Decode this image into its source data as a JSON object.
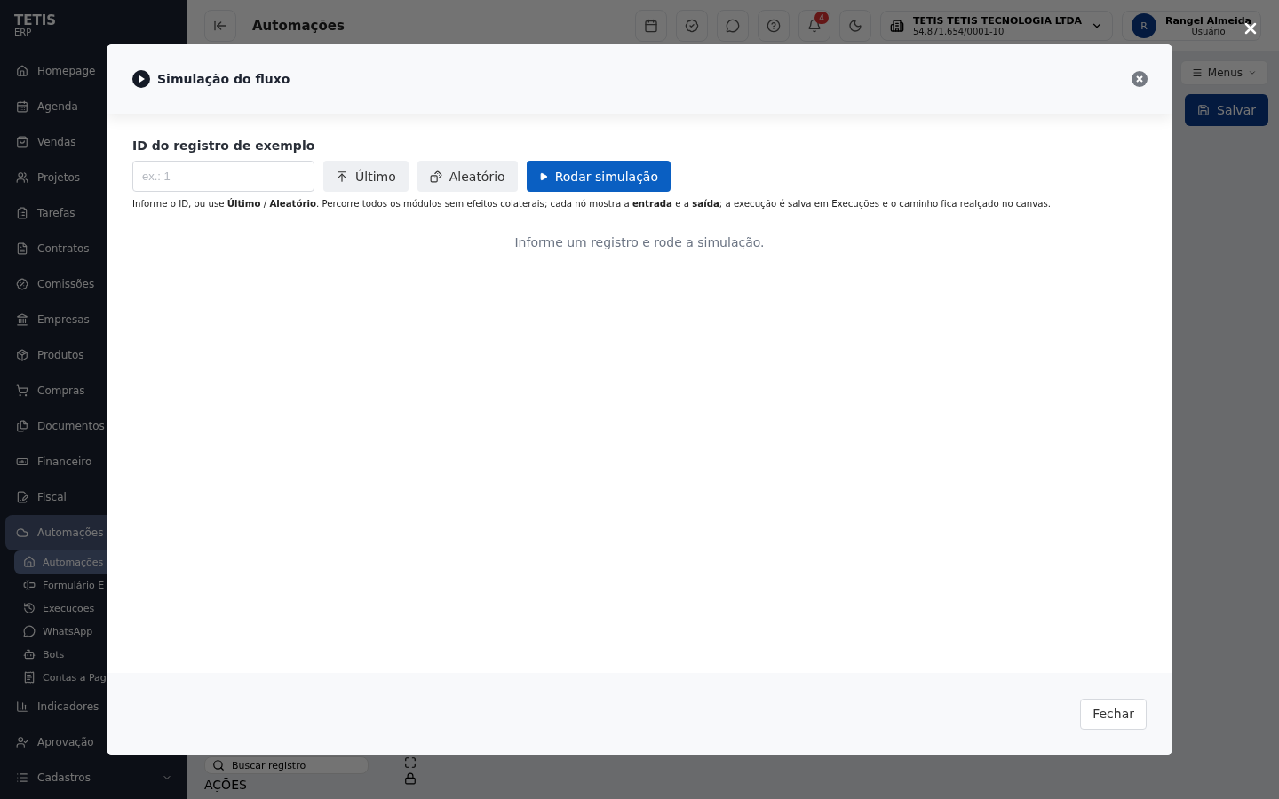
{
  "app": {
    "logo": {
      "name": "TETIS",
      "sub": "ERP"
    },
    "sidebar": {
      "items": [
        {
          "label": "Homepage",
          "selected": false
        },
        {
          "label": "Agenda",
          "selected": false
        },
        {
          "label": "Vendas",
          "selected": false
        },
        {
          "label": "Projetos",
          "selected": false
        },
        {
          "label": "Tarefas",
          "selected": false
        },
        {
          "label": "Contratos",
          "selected": false
        },
        {
          "label": "Comissões",
          "selected": false
        },
        {
          "label": "Empresas",
          "selected": false
        },
        {
          "label": "Produtos",
          "selected": false
        },
        {
          "label": "Compras",
          "selected": false
        },
        {
          "label": "Documentos",
          "selected": false
        },
        {
          "label": "Financeiro",
          "selected": false
        },
        {
          "label": "Fiscal",
          "selected": false
        },
        {
          "label": "Automações",
          "selected": true,
          "expanded": true,
          "children": [
            {
              "label": "Automações",
              "selected": true
            },
            {
              "label": "Formulário E",
              "selected": false
            },
            {
              "label": "Execuções",
              "selected": false
            },
            {
              "label": "WhatsApp",
              "selected": false
            },
            {
              "label": "Bots",
              "selected": false
            },
            {
              "label": "Contas a Pag",
              "selected": false
            }
          ]
        },
        {
          "label": "Indicadores",
          "selected": false
        },
        {
          "label": "Aprovação",
          "selected": false
        },
        {
          "label": "Cadastros",
          "selected": false,
          "expanded": false
        }
      ]
    },
    "topbar": {
      "title": "Automações",
      "notification_count": "4",
      "company": {
        "name": "TETIS TETIS TECNOLOGIA LTDA",
        "document": "54.871.654/0001-10"
      },
      "user": {
        "initial": "R",
        "name": "Rangel Almeida",
        "role": "Usuário"
      }
    },
    "toolbar": {
      "menus": "Menus",
      "save": "Salvar"
    },
    "canvas": {
      "search": "Buscar registro",
      "section": "AÇÕES"
    }
  },
  "modal": {
    "title": "Simulação do fluxo",
    "field_label": "ID do registro de exemplo",
    "placeholder": "ex.: 1",
    "buttons": [
      {
        "label": "Último",
        "kind": "last"
      },
      {
        "label": "Aleatório",
        "kind": "random"
      },
      {
        "label": "Rodar simulação",
        "kind": "run"
      }
    ],
    "help": "Informe o ID, ou use **Último** / **Aleatório**. Percorre todos os módulos sem efeitos colaterais; cada nó mostra a **entrada** e a **saída**; a execução é salva em Execuções e o caminho fica realçado no canvas.",
    "empty_state": "Informe um registro e rode a simulação.",
    "footer_button": "Fechar"
  }
}
